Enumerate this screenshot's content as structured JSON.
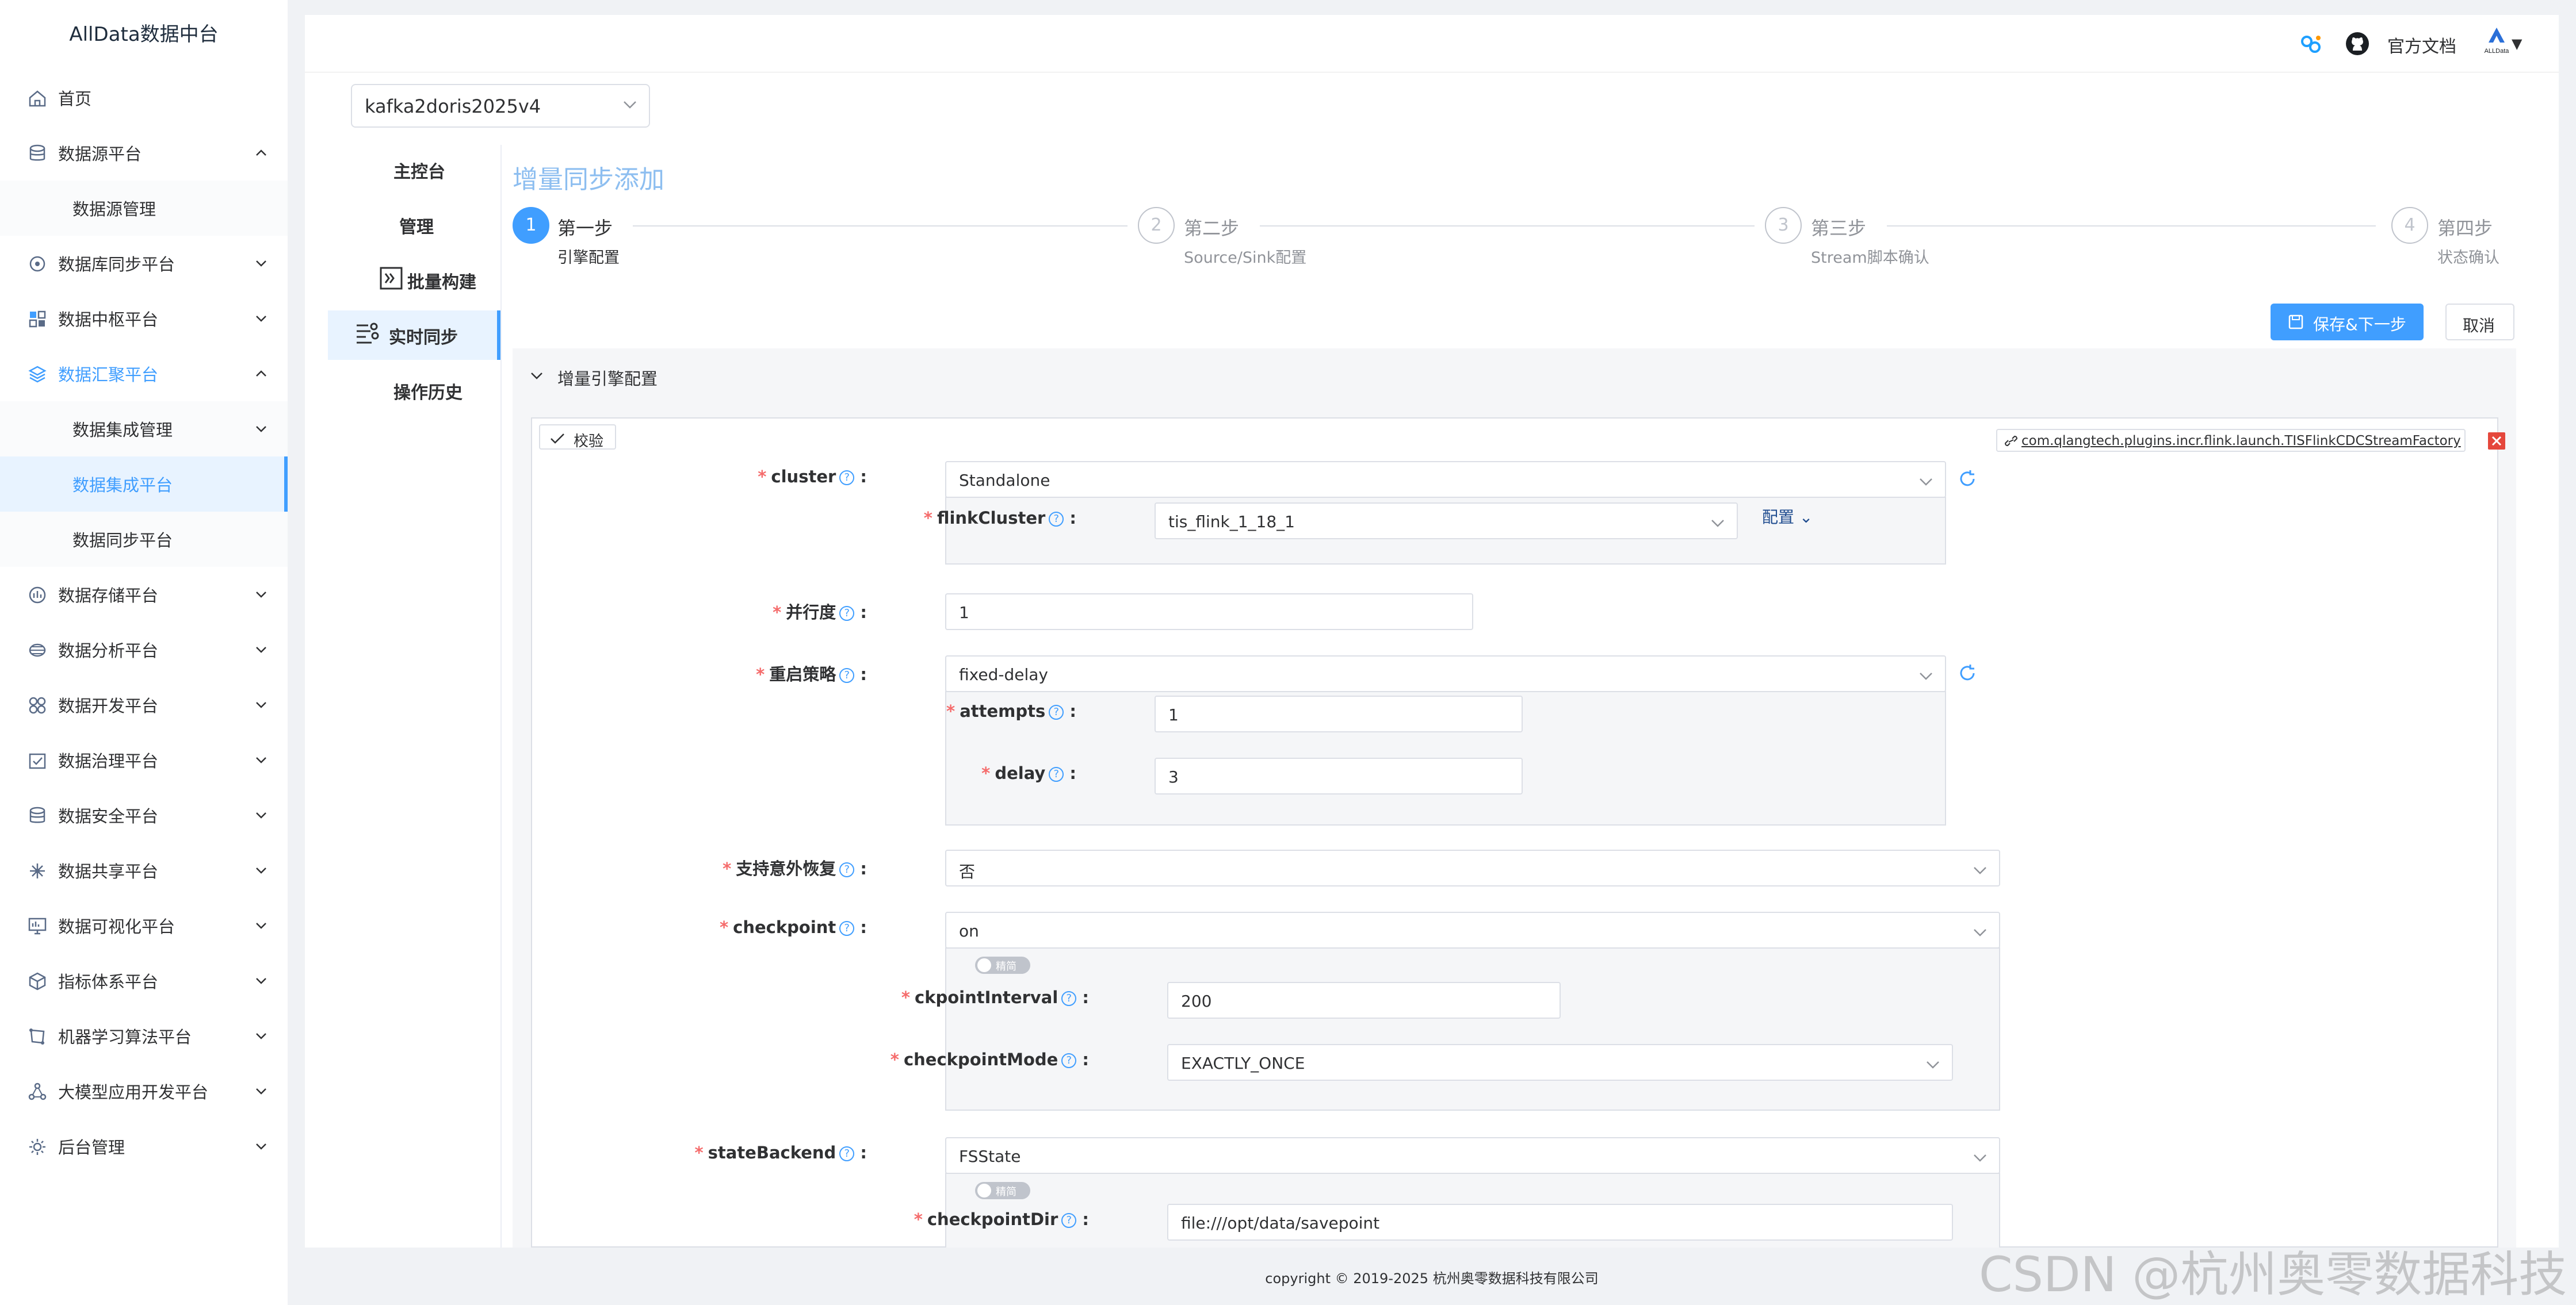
{
  "brand": "AllData数据中台",
  "sidebar": {
    "items": [
      {
        "label": "首页",
        "icon": "home-icon"
      },
      {
        "label": "数据源平台",
        "icon": "database-icon",
        "arrow": "up"
      },
      {
        "label": "数据源管理",
        "sub": true
      },
      {
        "label": "数据库同步平台",
        "icon": "sync-icon",
        "arrow": "down"
      },
      {
        "label": "数据中枢平台",
        "icon": "grid-icon",
        "arrow": "down"
      },
      {
        "label": "数据汇聚平台",
        "icon": "layers-icon",
        "arrow": "up"
      },
      {
        "label": "数据集成管理",
        "sub": true,
        "arrow": "down"
      },
      {
        "label": "数据集成平台",
        "sub": true,
        "active": true
      },
      {
        "label": "数据同步平台",
        "sub": true
      },
      {
        "label": "数据存储平台",
        "icon": "storage-icon",
        "arrow": "down"
      },
      {
        "label": "数据分析平台",
        "icon": "analysis-icon",
        "arrow": "down"
      },
      {
        "label": "数据开发平台",
        "icon": "dev-icon",
        "arrow": "down"
      },
      {
        "label": "数据治理平台",
        "icon": "governance-icon",
        "arrow": "down"
      },
      {
        "label": "数据安全平台",
        "icon": "security-icon",
        "arrow": "down"
      },
      {
        "label": "数据共享平台",
        "icon": "share-icon",
        "arrow": "down"
      },
      {
        "label": "数据可视化平台",
        "icon": "monitor-icon",
        "arrow": "down"
      },
      {
        "label": "指标体系平台",
        "icon": "cube-icon",
        "arrow": "down"
      },
      {
        "label": "机器学习算法平台",
        "icon": "ml-icon",
        "arrow": "down"
      },
      {
        "label": "大模型应用开发平台",
        "icon": "llm-icon",
        "arrow": "down"
      },
      {
        "label": "后台管理",
        "icon": "settings-icon",
        "arrow": "down"
      }
    ]
  },
  "header": {
    "doc_label": "官方文档",
    "avatar_label": "ALLData",
    "dropdown_arrow": "▼"
  },
  "project_select": "kafka2doris2025v4",
  "subnav": [
    {
      "label": "主控台"
    },
    {
      "label": "管理"
    },
    {
      "label": "批量构建",
      "icon": "batch-icon"
    },
    {
      "label": "实时同步",
      "icon": "realtime-icon",
      "active": true
    },
    {
      "label": "操作历史"
    }
  ],
  "page_title": "增量同步添加",
  "steps": [
    {
      "num": "1",
      "title": "第一步",
      "desc": "引擎配置",
      "active": true
    },
    {
      "num": "2",
      "title": "第二步",
      "desc": "Source/Sink配置"
    },
    {
      "num": "3",
      "title": "第三步",
      "desc": "Stream脚本确认"
    },
    {
      "num": "4",
      "title": "第四步",
      "desc": "状态确认"
    }
  ],
  "buttons": {
    "save_next": "保存&下一步",
    "cancel": "取消"
  },
  "panel": {
    "title": "增量引擎配置",
    "verify": "校验",
    "plugin": "com.qlangtech.plugins.incr.flink.launch.TISFlinkCDCStreamFactory",
    "config_link": "配置",
    "toggle_label": "精简"
  },
  "form": {
    "cluster": {
      "label": "cluster",
      "value": "Standalone"
    },
    "flinkCluster": {
      "label": "flinkCluster",
      "value": "tis_flink_1_18_1"
    },
    "parallel": {
      "label": "并行度",
      "value": "1"
    },
    "restart": {
      "label": "重启策略",
      "value": "fixed-delay"
    },
    "attempts": {
      "label": "attempts",
      "value": "1"
    },
    "delay": {
      "label": "delay",
      "value": "3"
    },
    "recover": {
      "label": "支持意外恢复",
      "value": "否"
    },
    "checkpoint": {
      "label": "checkpoint",
      "value": "on"
    },
    "ckpointInterval": {
      "label": "ckpointInterval",
      "value": "200"
    },
    "checkpointMode": {
      "label": "checkpointMode",
      "value": "EXACTLY_ONCE"
    },
    "stateBackend": {
      "label": "stateBackend",
      "value": "FSState"
    },
    "checkpointDir": {
      "label": "checkpointDir",
      "value": "file:///opt/data/savepoint"
    }
  },
  "footer": "copyright © 2019-2025 杭州奥零数据科技有限公司",
  "watermark": "CSDN @杭州奥零数据科技",
  "colors": {
    "accent": "#409eff",
    "required": "#f56c6c",
    "close": "#e5473c"
  }
}
